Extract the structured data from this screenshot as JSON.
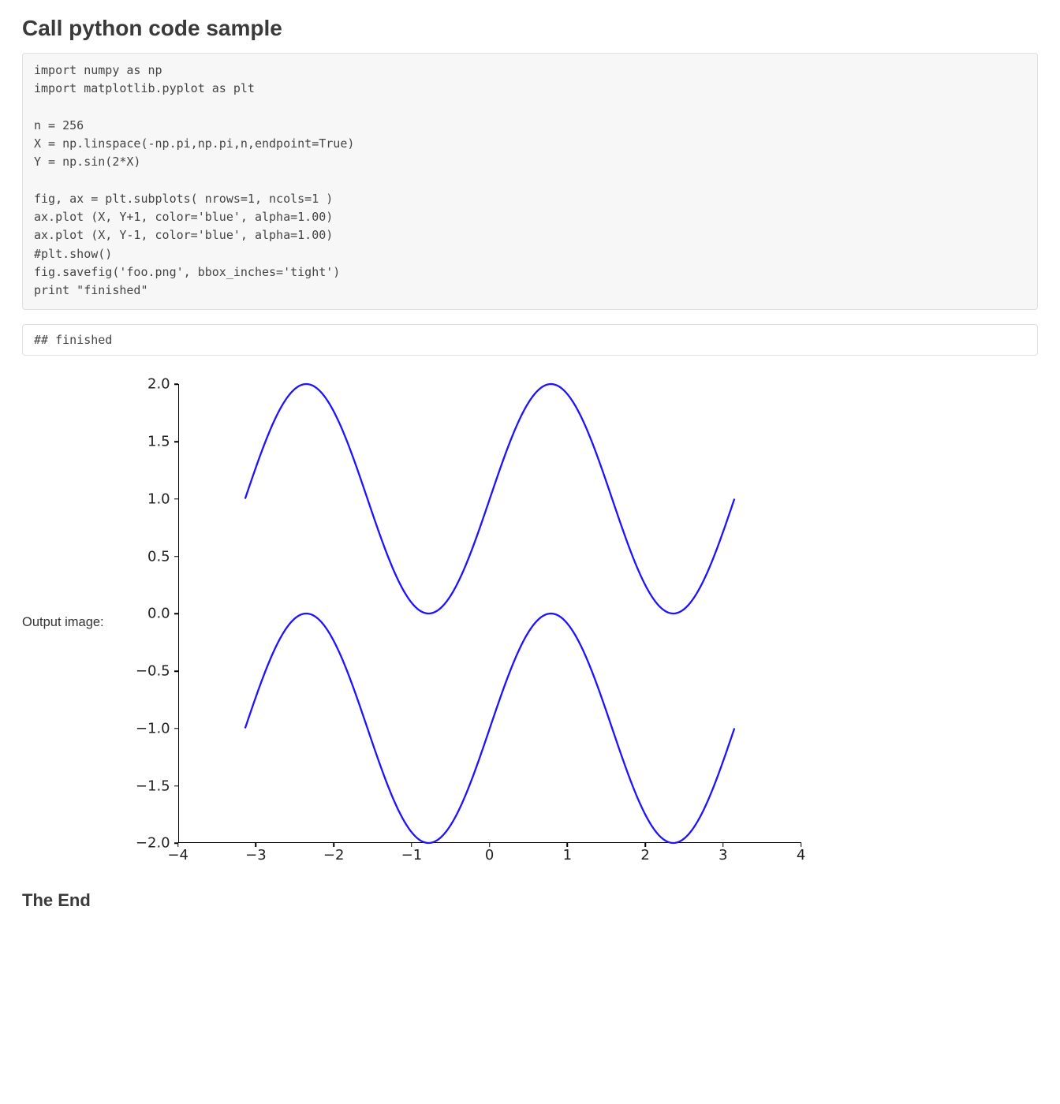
{
  "heading": "Call python code sample",
  "code": "import numpy as np\nimport matplotlib.pyplot as plt\n\nn = 256\nX = np.linspace(-np.pi,np.pi,n,endpoint=True)\nY = np.sin(2*X)\n\nfig, ax = plt.subplots( nrows=1, ncols=1 )\nax.plot (X, Y+1, color='blue', alpha=1.00)\nax.plot (X, Y-1, color='blue', alpha=1.00)\n#plt.show()\nfig.savefig('foo.png', bbox_inches='tight')\nprint \"finished\"",
  "output": "## finished",
  "image_label": "Output image:",
  "footer": "The End",
  "chart_data": {
    "type": "line",
    "title": "",
    "xlabel": "",
    "ylabel": "",
    "xlim": [
      -4,
      4
    ],
    "ylim": [
      -2.0,
      2.0
    ],
    "x_ticks": [
      -4,
      -3,
      -2,
      -1,
      0,
      1,
      2,
      3,
      4
    ],
    "y_ticks": [
      -2.0,
      -1.5,
      -1.0,
      -0.5,
      0.0,
      0.5,
      1.0,
      1.5,
      2.0
    ],
    "x_tick_labels": [
      "−4",
      "−3",
      "−2",
      "−1",
      "0",
      "1",
      "2",
      "3",
      "4"
    ],
    "y_tick_labels": [
      "−2.0",
      "−1.5",
      "−1.0",
      "−0.5",
      "0.0",
      "0.5",
      "1.0",
      "1.5",
      "2.0"
    ],
    "x_data_range": [
      -3.14159265,
      3.14159265
    ],
    "n_points": 256,
    "series": [
      {
        "name": "sin(2x)+1",
        "color": "#1f12ff",
        "formula": "sin(2*x)+1"
      },
      {
        "name": "sin(2x)-1",
        "color": "#1f12ff",
        "formula": "sin(2*x)-1"
      }
    ]
  }
}
